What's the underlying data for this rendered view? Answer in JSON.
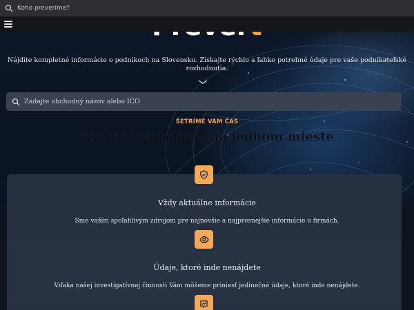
{
  "topbar": {
    "search_placeholder": "Koho preveríme?"
  },
  "hero": {
    "logo_main": "Prever",
    "logo_accent": "to",
    "tagline": "Nájdite kompletné informácie o podnikoch na Slovensku. Získajte rýchlo a ľahko potrebné údaje pre vaše podnikateľské rozhodnutia.",
    "search_placeholder": "Zadajte obchodný názov alebo IČO"
  },
  "section": {
    "eyebrow": "ŠETRÍME VÁM ČAS",
    "title": "Všetky informácie na jednom mieste"
  },
  "features": [
    {
      "icon": "shield-check-icon",
      "title": "Vždy aktuálne informácie",
      "description": "Sme vaším spoľahlivým zdrojom pre najnovšie a najpresnejšie informácie o firmách."
    },
    {
      "icon": "eye-icon",
      "title": "Údaje, ktoré inde nenájdete",
      "description": "Vďaka našej investigatívnej činnosti Vám môžeme priniesť jedinečné údaje, ktoré inde nenájdete."
    },
    {
      "icon": "chart-icon",
      "title": "",
      "description": ""
    }
  ],
  "colors": {
    "accent": "#f3a24b",
    "card": "#263041",
    "topbar": "#2d2f33"
  }
}
